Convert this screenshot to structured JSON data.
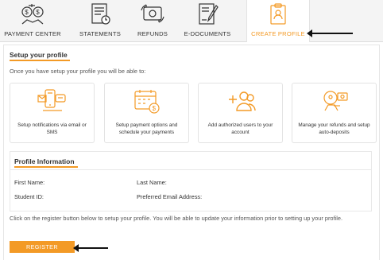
{
  "tabs": [
    {
      "label": "PAYMENT CENTER",
      "icon": "payment-center-icon"
    },
    {
      "label": "STATEMENTS",
      "icon": "statements-icon"
    },
    {
      "label": "REFUNDS",
      "icon": "refunds-icon"
    },
    {
      "label": "E-DOCUMENTS",
      "icon": "e-documents-icon"
    },
    {
      "label": "CREATE PROFILE",
      "icon": "create-profile-icon",
      "active": true
    }
  ],
  "setup": {
    "title": "Setup your profile",
    "subtitle": "Once you have setup your profile you will be able to:",
    "cards": [
      {
        "icon": "notifications-icon",
        "text": "Setup notifications via email or SMS"
      },
      {
        "icon": "calendar-payment-icon",
        "text": "Setup payment options and schedule your payments"
      },
      {
        "icon": "add-user-icon",
        "text": "Add authorized users to your account"
      },
      {
        "icon": "refund-deposit-icon",
        "text": "Manage your refunds and setup auto-deposits"
      }
    ]
  },
  "profile_info": {
    "title": "Profile Information",
    "first_name": "First Name:",
    "last_name": "Last Name:",
    "student_id": "Student ID:",
    "preferred_email": "Preferred Email Address:"
  },
  "note": "Click on the register button below to setup your profile. You will be able to update your information prior to setting up your profile.",
  "register_button": "REGISTER",
  "colors": {
    "accent": "#f39a26",
    "arrow": "#111111"
  }
}
